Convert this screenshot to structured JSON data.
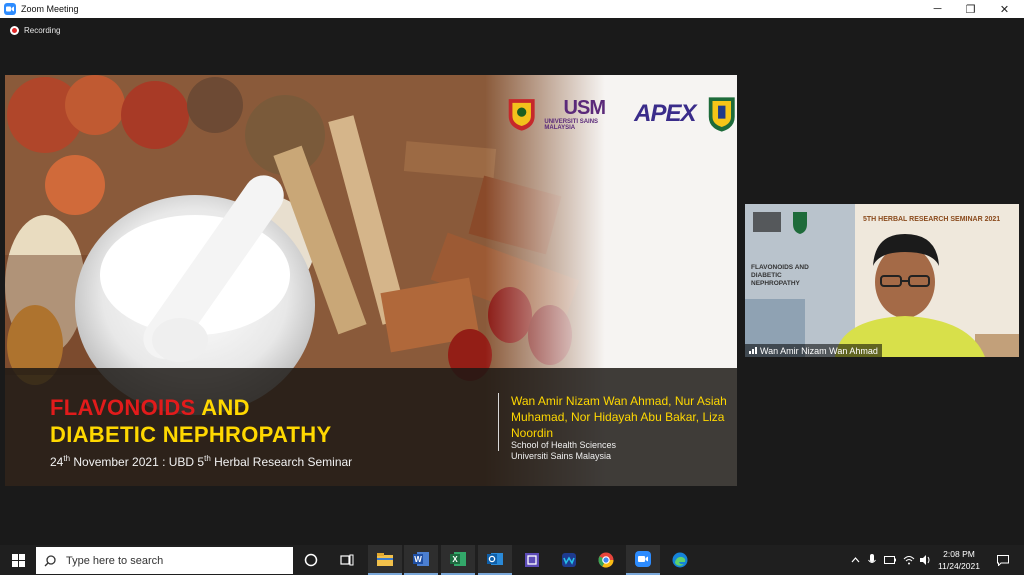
{
  "window": {
    "title": "Zoom Meeting",
    "minimize": "─",
    "restore": "❐",
    "close": "✕"
  },
  "recording": {
    "label": "Recording"
  },
  "slide": {
    "title_line1": "FLAVONOIDS",
    "title_and": " AND",
    "title_line2": "DIABETIC NEPHROPATHY",
    "date_day": "24",
    "date_suffix": "th",
    "date_rest": " November 2021 : UBD 5",
    "seminar_suffix": "th",
    "seminar_rest": " Herbal Research Seminar",
    "authors": "Wan Amir Nizam Wan Ahmad, Nur Asiah Muhamad, Nor Hidayah Abu Bakar, Liza Noordin",
    "school": "School of Health Sciences",
    "university": "Universiti Sains Malaysia",
    "logo_usm": "USM",
    "logo_usm_sub": "UNIVERSITI SAINS MALAYSIA",
    "logo_apex": "APEX"
  },
  "video": {
    "participant_name": "Wan Amir Nizam Wan Ahmad",
    "banner": "5TH HERBAL RESEARCH SEMINAR 2021",
    "mini_title": "FLAVONOIDS AND DIABETIC NEPHROPATHY"
  },
  "taskbar": {
    "search_placeholder": "Type here to search",
    "time": "2:08 PM",
    "date": "11/24/2021"
  },
  "colors": {
    "zoom_blue": "#2d8cff",
    "title_red": "#e21b1b",
    "title_yellow": "#ffd800",
    "recording_red": "#e02828"
  }
}
